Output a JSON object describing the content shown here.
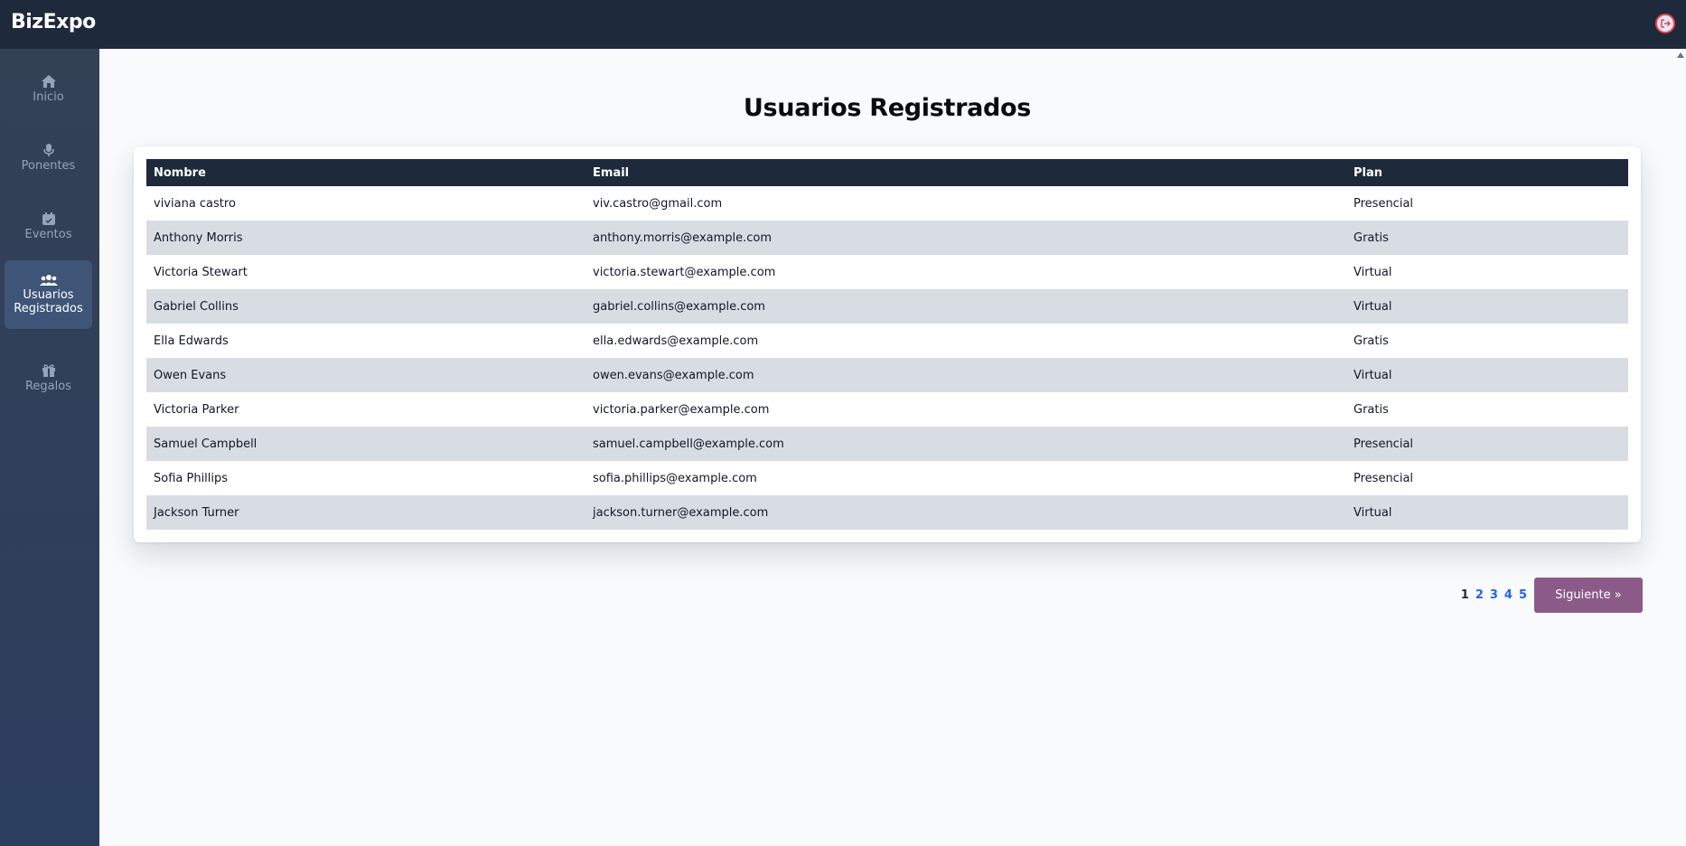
{
  "app": {
    "logo": "BizExpo"
  },
  "sidebar": {
    "items": [
      {
        "label": "Inicio",
        "icon": "home-icon",
        "active": false
      },
      {
        "label": "Ponentes",
        "icon": "microphone-icon",
        "active": false
      },
      {
        "label": "Eventos",
        "icon": "calendar-check-icon",
        "active": false
      },
      {
        "label": "Usuarios Registrados",
        "icon": "users-icon",
        "active": true
      },
      {
        "label": "Regalos",
        "icon": "gift-icon",
        "active": false
      }
    ]
  },
  "header": {
    "logout_icon": "logout-icon"
  },
  "main": {
    "title": "Usuarios Registrados",
    "table": {
      "columns": [
        "Nombre",
        "Email",
        "Plan"
      ],
      "rows": [
        [
          "viviana castro",
          "viv.castro@gmail.com",
          "Presencial"
        ],
        [
          "Anthony Morris",
          "anthony.morris@example.com",
          "Gratis"
        ],
        [
          "Victoria Stewart",
          "victoria.stewart@example.com",
          "Virtual"
        ],
        [
          "Gabriel Collins",
          "gabriel.collins@example.com",
          "Virtual"
        ],
        [
          "Ella Edwards",
          "ella.edwards@example.com",
          "Gratis"
        ],
        [
          "Owen Evans",
          "owen.evans@example.com",
          "Virtual"
        ],
        [
          "Victoria Parker",
          "victoria.parker@example.com",
          "Gratis"
        ],
        [
          "Samuel Campbell",
          "samuel.campbell@example.com",
          "Presencial"
        ],
        [
          "Sofia Phillips",
          "sofia.phillips@example.com",
          "Presencial"
        ],
        [
          "Jackson Turner",
          "jackson.turner@example.com",
          "Virtual"
        ]
      ]
    },
    "pagination": {
      "pages": [
        "1",
        "2",
        "3",
        "4",
        "5"
      ],
      "current": "1",
      "next_label": "Siguiente »"
    }
  },
  "colors": {
    "topbar": "#1e293b",
    "sidebar": "#334155",
    "sidebar_active": "#3f5578",
    "table_header": "#1e293b",
    "row_alt": "#d8dde3",
    "page_link": "#2563eb",
    "next_button": "#8b5a88"
  }
}
